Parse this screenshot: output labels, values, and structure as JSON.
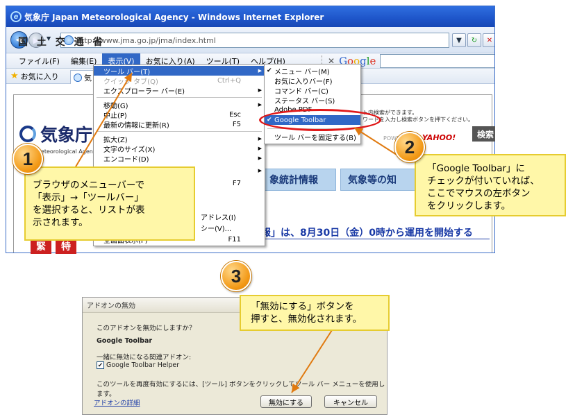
{
  "browser": {
    "title": "気象庁 Japan Meteorological Agency - Windows Internet Explorer",
    "url": "http://www.jma.go.jp/jma/index.html",
    "menus": [
      "ファイル(F)",
      "編集(E)",
      "表示(V)",
      "お気に入り(A)",
      "ツール(T)",
      "ヘルプ(H)"
    ],
    "google_logo": "Google",
    "favorites_label": "お気に入り",
    "tab_label": "気"
  },
  "page": {
    "ministry": "国 土 交 通 省",
    "agency_name": "気象庁",
    "agency_sub": "Meteorological Agency",
    "search_note_1": "ト内検索ができます。",
    "search_note_2": "ワードを入力し検索ボタンを押下ください。",
    "powered_by": "POWERED BY",
    "yahoo": "YAHOO!",
    "search_button": "検索",
    "nav_tab_1": "象統計情報",
    "nav_tab_2": "気象等の知",
    "notice": "警報」は、8月30日（金）0時から運用を開始する",
    "red_box_1": "緊",
    "red_box_2": "特"
  },
  "view_menu": {
    "items": [
      {
        "label": "ツール バー(T)",
        "shortcut": "",
        "submenu": true
      },
      {
        "label": "クイック タブ(Q)",
        "shortcut": "Ctrl+Q",
        "submenu": false
      },
      {
        "label": "エクスプローラー バー(E)",
        "shortcut": "",
        "submenu": true
      },
      {
        "label": "移動(G)",
        "shortcut": "",
        "submenu": true
      },
      {
        "label": "中止(P)",
        "shortcut": "Esc",
        "submenu": false
      },
      {
        "label": "最新の情報に更新(R)",
        "shortcut": "F5",
        "submenu": false
      },
      {
        "label": "拡大(Z)",
        "shortcut": "",
        "submenu": true
      },
      {
        "label": "文字のサイズ(X)",
        "shortcut": "",
        "submenu": true
      },
      {
        "label": "エンコード(D)",
        "shortcut": "",
        "submenu": true
      },
      {
        "label": "F7"
      },
      {
        "label": "アドレス(I)"
      },
      {
        "label": "シー(V)..."
      },
      {
        "label": "全画面表示(F)",
        "shortcut": "F11"
      }
    ]
  },
  "toolbar_submenu": {
    "items": [
      "メニュー バー(M)",
      "お気に入りバー(F)",
      "コマンド バー(C)",
      "ステータス バー(S)",
      "Adobe PDF",
      "Google Toolbar",
      "ツール バーを固定する(B)"
    ]
  },
  "callouts": {
    "c1_number": "1",
    "c1_line1": "ブラウザのメニューバーで",
    "c1_line2": "「表示」→「ツールバー」",
    "c1_line3": "を選択すると、リストが表",
    "c1_line4": "示されます。",
    "c2_number": "2",
    "c2_line1": "「Google Toolbar」に",
    "c2_line2": "チェックが付いていれば、",
    "c2_line3": "ここでマウスの左ボタン",
    "c2_line4": "をクリックします。",
    "c3_number": "3",
    "c3_line1": "「無効にする」ボタンを",
    "c3_line2": "押すと、無効化されます。"
  },
  "dialog": {
    "title": "アドオンの無効",
    "question": "このアドオンを無効にしますか？",
    "addon_name": "Google Toolbar",
    "related_label": "一緒に無効になる関連アドオン:",
    "related_item": "Google Toolbar Helper",
    "hint": "このツールを再度有効にするには、[ツール] ボタンをクリックしてツール バー メニューを使用します。",
    "details_link": "アドオンの詳細",
    "disable_button": "無効にする",
    "cancel_button": "キャンセル"
  },
  "colors": {
    "callout_fill": "#fff7a8",
    "badge_orange": "#f39a18",
    "highlight_red": "#e01818",
    "menu_highlight": "#3168c6"
  }
}
